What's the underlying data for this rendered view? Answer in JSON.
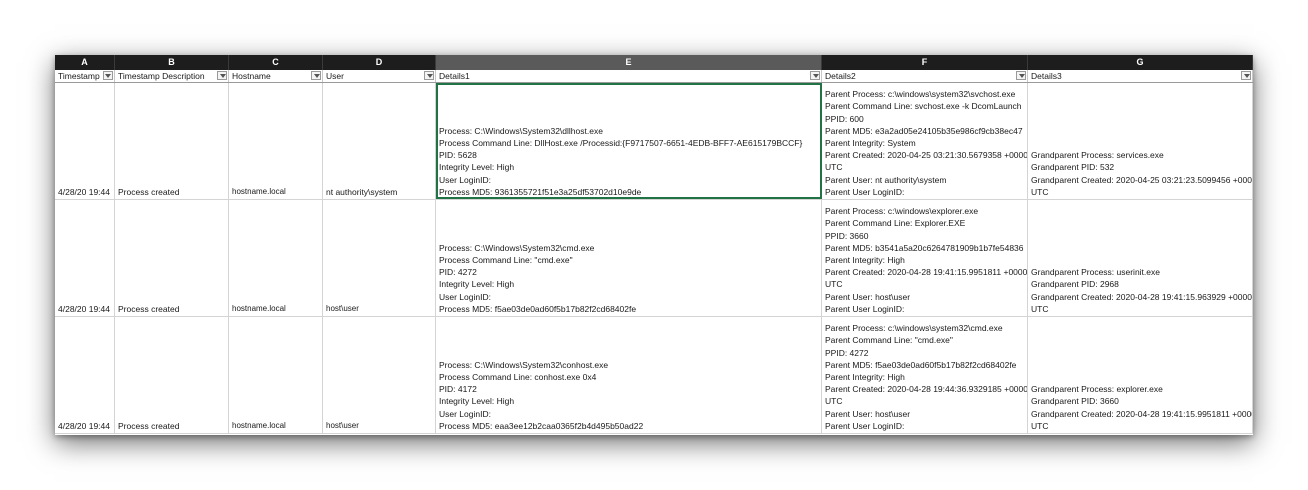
{
  "columns": [
    {
      "letter": "A",
      "header": "Timestamp"
    },
    {
      "letter": "B",
      "header": "Timestamp Description"
    },
    {
      "letter": "C",
      "header": "Hostname"
    },
    {
      "letter": "D",
      "header": "User"
    },
    {
      "letter": "E",
      "header": "Details1"
    },
    {
      "letter": "F",
      "header": "Details2"
    },
    {
      "letter": "G",
      "header": "Details3"
    }
  ],
  "rows": [
    {
      "timestamp": "4/28/20 19:44",
      "description": "Process created",
      "hostname": "hostname.local",
      "user": "nt authority\\system",
      "details1": [
        "Process: C:\\Windows\\System32\\dllhost.exe",
        "Process Command Line: DllHost.exe /Processid:{F9717507-6651-4EDB-BFF7-AE615179BCCF}",
        "PID: 5628",
        "Integrity Level: High",
        "User LoginID:",
        "Process MD5: 9361355721f51e3a25df53702d10e9de"
      ],
      "details2": [
        "Parent Process: c:\\windows\\system32\\svchost.exe",
        "Parent Command Line: svchost.exe -k DcomLaunch",
        "PPID: 600",
        "Parent MD5: e3a2ad05e24105b35e986cf9cb38ec47",
        "Parent Integrity: System",
        "Parent Created: 2020-04-25 03:21:30.5679358 +0000",
        "UTC",
        "Parent User: nt authority\\system",
        "Parent User LoginID:"
      ],
      "details3": [
        "Grandparent Process: services.exe",
        "Grandparent PID: 532",
        "Grandparent Created: 2020-04-25 03:21:23.5099456 +0000",
        "UTC"
      ]
    },
    {
      "timestamp": "4/28/20 19:44",
      "description": "Process created",
      "hostname": "hostname.local",
      "user": "host\\user",
      "details1": [
        "Process: C:\\Windows\\System32\\cmd.exe",
        "Process Command Line: \"cmd.exe\"",
        "PID: 4272",
        "Integrity Level: High",
        "User LoginID:",
        "Process MD5: f5ae03de0ad60f5b17b82f2cd68402fe"
      ],
      "details2": [
        "Parent Process: c:\\windows\\explorer.exe",
        "Parent Command Line: Explorer.EXE",
        "PPID: 3660",
        "Parent MD5: b3541a5a20c6264781909b1b7fe54836",
        "Parent Integrity: High",
        "Parent Created: 2020-04-28 19:41:15.9951811 +0000",
        "UTC",
        "Parent User: host\\user",
        "Parent User LoginID:"
      ],
      "details3": [
        "Grandparent Process: userinit.exe",
        "Grandparent PID: 2968",
        "Grandparent Created: 2020-04-28 19:41:15.963929 +0000",
        "UTC"
      ]
    },
    {
      "timestamp": "4/28/20 19:44",
      "description": "Process created",
      "hostname": "hostname.local",
      "user": "host\\user",
      "details1": [
        "Process: C:\\Windows\\System32\\conhost.exe",
        "Process Command Line: conhost.exe 0x4",
        "PID: 4172",
        "Integrity Level: High",
        "User LoginID:",
        "Process MD5: eaa3ee12b2caa0365f2b4d495b50ad22"
      ],
      "details2": [
        "Parent Process: c:\\windows\\system32\\cmd.exe",
        "Parent Command Line: \"cmd.exe\"",
        "PPID: 4272",
        "Parent MD5: f5ae03de0ad60f5b17b82f2cd68402fe",
        "Parent Integrity: High",
        "Parent Created: 2020-04-28 19:44:36.9329185 +0000",
        "UTC",
        "Parent User: host\\user",
        "Parent User LoginID:"
      ],
      "details3": [
        "Grandparent Process: explorer.exe",
        "Grandparent PID: 3660",
        "Grandparent Created: 2020-04-28 19:41:15.9951811 +0000",
        "UTC"
      ]
    }
  ]
}
